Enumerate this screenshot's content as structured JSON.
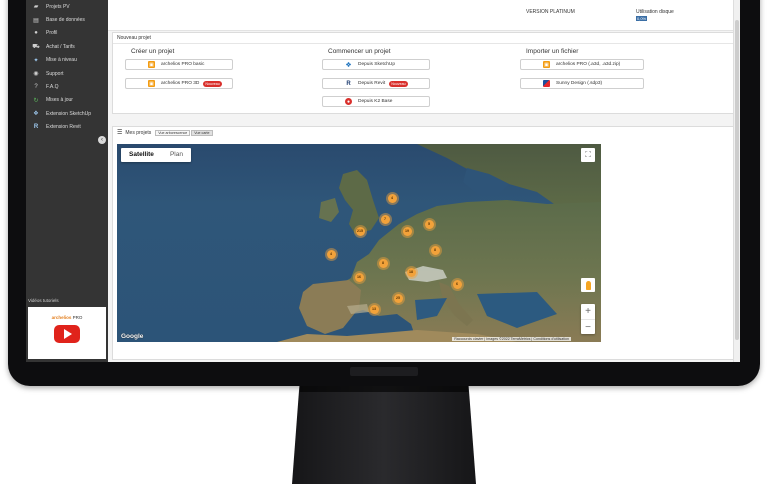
{
  "sidebar": {
    "items": [
      {
        "label": "Projets PV",
        "icon": "folder-icon"
      },
      {
        "label": "Base de données",
        "icon": "database-icon"
      },
      {
        "label": "Profil",
        "icon": "user-icon"
      },
      {
        "label": "Achat / Tarifs",
        "icon": "cart-icon"
      },
      {
        "label": "Mise à niveau",
        "icon": "upgrade-icon"
      },
      {
        "label": "Support",
        "icon": "lifebuoy-icon"
      },
      {
        "label": "F.A.Q",
        "icon": "question-icon"
      },
      {
        "label": "Mises à jour",
        "icon": "refresh-icon"
      },
      {
        "label": "Extension SketchUp",
        "icon": "sketchup-icon"
      },
      {
        "label": "Extension Revit",
        "icon": "revit-icon"
      }
    ],
    "tutorials_label": "Vidéos tutoriels",
    "tutorial_logo": "archelios",
    "tutorial_logo_suffix": "PRO"
  },
  "topbar": {
    "version": "VERSION PLATINUM",
    "disk_label": "Utilisation disque",
    "disk_value": "0,0%"
  },
  "new_project": {
    "title": "Nouveau projet",
    "columns": [
      {
        "title": "Créer un projet",
        "buttons": [
          {
            "label": "archelios PRO basic",
            "icon": "archelios-icon",
            "new": false
          },
          {
            "label": "archelios PRO 3D",
            "icon": "archelios-icon",
            "new": true
          }
        ]
      },
      {
        "title": "Commencer un projet",
        "buttons": [
          {
            "label": "Depuis SketchUp",
            "icon": "sketchup-icon",
            "new": false
          },
          {
            "label": "Depuis Revit",
            "icon": "revit-icon",
            "new": true
          },
          {
            "label": "Depuis K2 Base",
            "icon": "k2-icon",
            "new": false
          }
        ]
      },
      {
        "title": "Importer un fichier",
        "buttons": [
          {
            "label": "archelios PRO (.a3d, .a3d.zip)",
            "icon": "archelios-icon",
            "new": false
          },
          {
            "label": "Sunny Design (.sdp3)",
            "icon": "sma-icon",
            "new": false
          }
        ]
      }
    ],
    "new_badge": "Nouveau"
  },
  "my_projects": {
    "title": "Mes projets",
    "tab_tree": "Vue arborescence",
    "tab_map": "Vue carte"
  },
  "map": {
    "type_satellite": "Satellite",
    "type_plan": "Plan",
    "zoom_in": "+",
    "zoom_out": "−",
    "google": "Google",
    "attribution": "Raccourcis clavier | Images ©2022 TerraMetrics | Conditions d'utilisation",
    "clusters": [
      {
        "label": "4"
      },
      {
        "label": "7"
      },
      {
        "label": "5"
      },
      {
        "label": "215"
      },
      {
        "label": "19"
      },
      {
        "label": "8"
      },
      {
        "label": "4"
      },
      {
        "label": "8"
      },
      {
        "label": "18"
      },
      {
        "label": "16"
      },
      {
        "label": "6"
      },
      {
        "label": "25"
      },
      {
        "label": "13"
      }
    ]
  }
}
